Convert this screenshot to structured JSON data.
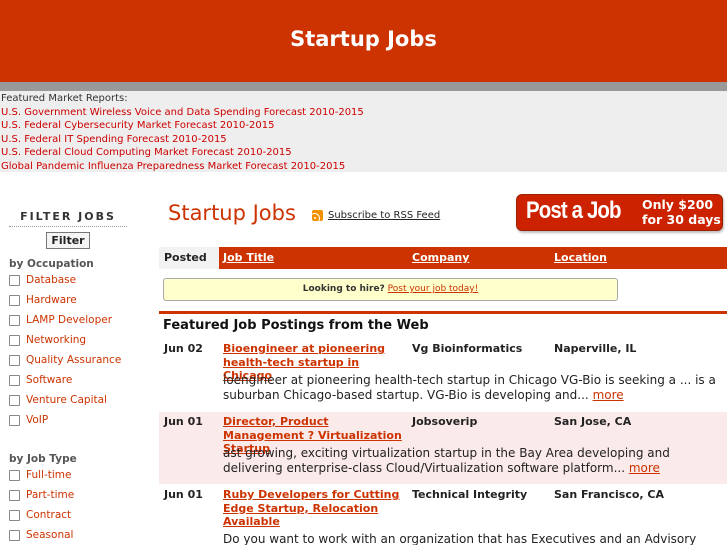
{
  "header": {
    "title": "Startup Jobs"
  },
  "reports": {
    "lead": "Featured Market Reports:",
    "links": [
      "U.S. Government Wireless Voice and Data Spending Forecast 2010-2015",
      "U.S. Federal Cybersecurity Market Forecast 2010-2015",
      "U.S. Federal IT Spending Forecast 2010-2015",
      "U.S. Federal Cloud Computing Market Forecast 2010-2015",
      "Global Pandemic Influenza Preparedness Market Forecast 2010-2015"
    ]
  },
  "sidebar": {
    "title": "FILTER JOBS",
    "button": "Filter",
    "occupation": {
      "title": "by Occupation",
      "options": [
        "Database",
        "Hardware",
        "LAMP Developer",
        "Networking",
        "Quality Assurance",
        "Software",
        "Venture Capital",
        "VoIP"
      ]
    },
    "job_type": {
      "title": "by Job Type",
      "options": [
        "Full-time",
        "Part-time",
        "Contract",
        "Seasonal"
      ]
    }
  },
  "main": {
    "title": "Startup Jobs",
    "rss_label": "Subscribe to RSS Feed",
    "post_job": {
      "main": "Post a Job",
      "line1": "Only $200",
      "line2": "for 30 days"
    },
    "columns": {
      "posted": "Posted",
      "title": "Job Title",
      "company": "Company",
      "location": "Location"
    },
    "notice": {
      "text": "Looking to hire?",
      "link": "Post your job today!"
    },
    "featured_heading": "Featured Job Postings from the Web",
    "more_label": "more",
    "jobs": [
      {
        "date": "Jun 02",
        "title": "Bioengineer at pioneering health-tech startup in Chicago",
        "company": "Vg Bioinformatics",
        "location": "Naperville, IL",
        "desc": "ioengineer at pioneering health-tech startup in Chicago VG-Bio is seeking a ... is a suburban Chicago-based startup. VG-Bio is developing and..."
      },
      {
        "date": "Jun 01",
        "title": "Director, Product Management ? Virtualization Startup",
        "company": "Jobsoverip",
        "location": "San Jose, CA",
        "desc": "ast growing, exciting virtualization startup in the Bay Area developing and delivering enterprise-class Cloud/Virtualization software platform..."
      },
      {
        "date": "Jun 01",
        "title": "Ruby Developers for Cutting Edge Startup, Relocation Available",
        "company": "Technical Integrity",
        "location": "San Francisco, CA",
        "desc": "Do you want to work with an organization that has Executives and an Advisory Board"
      }
    ]
  }
}
